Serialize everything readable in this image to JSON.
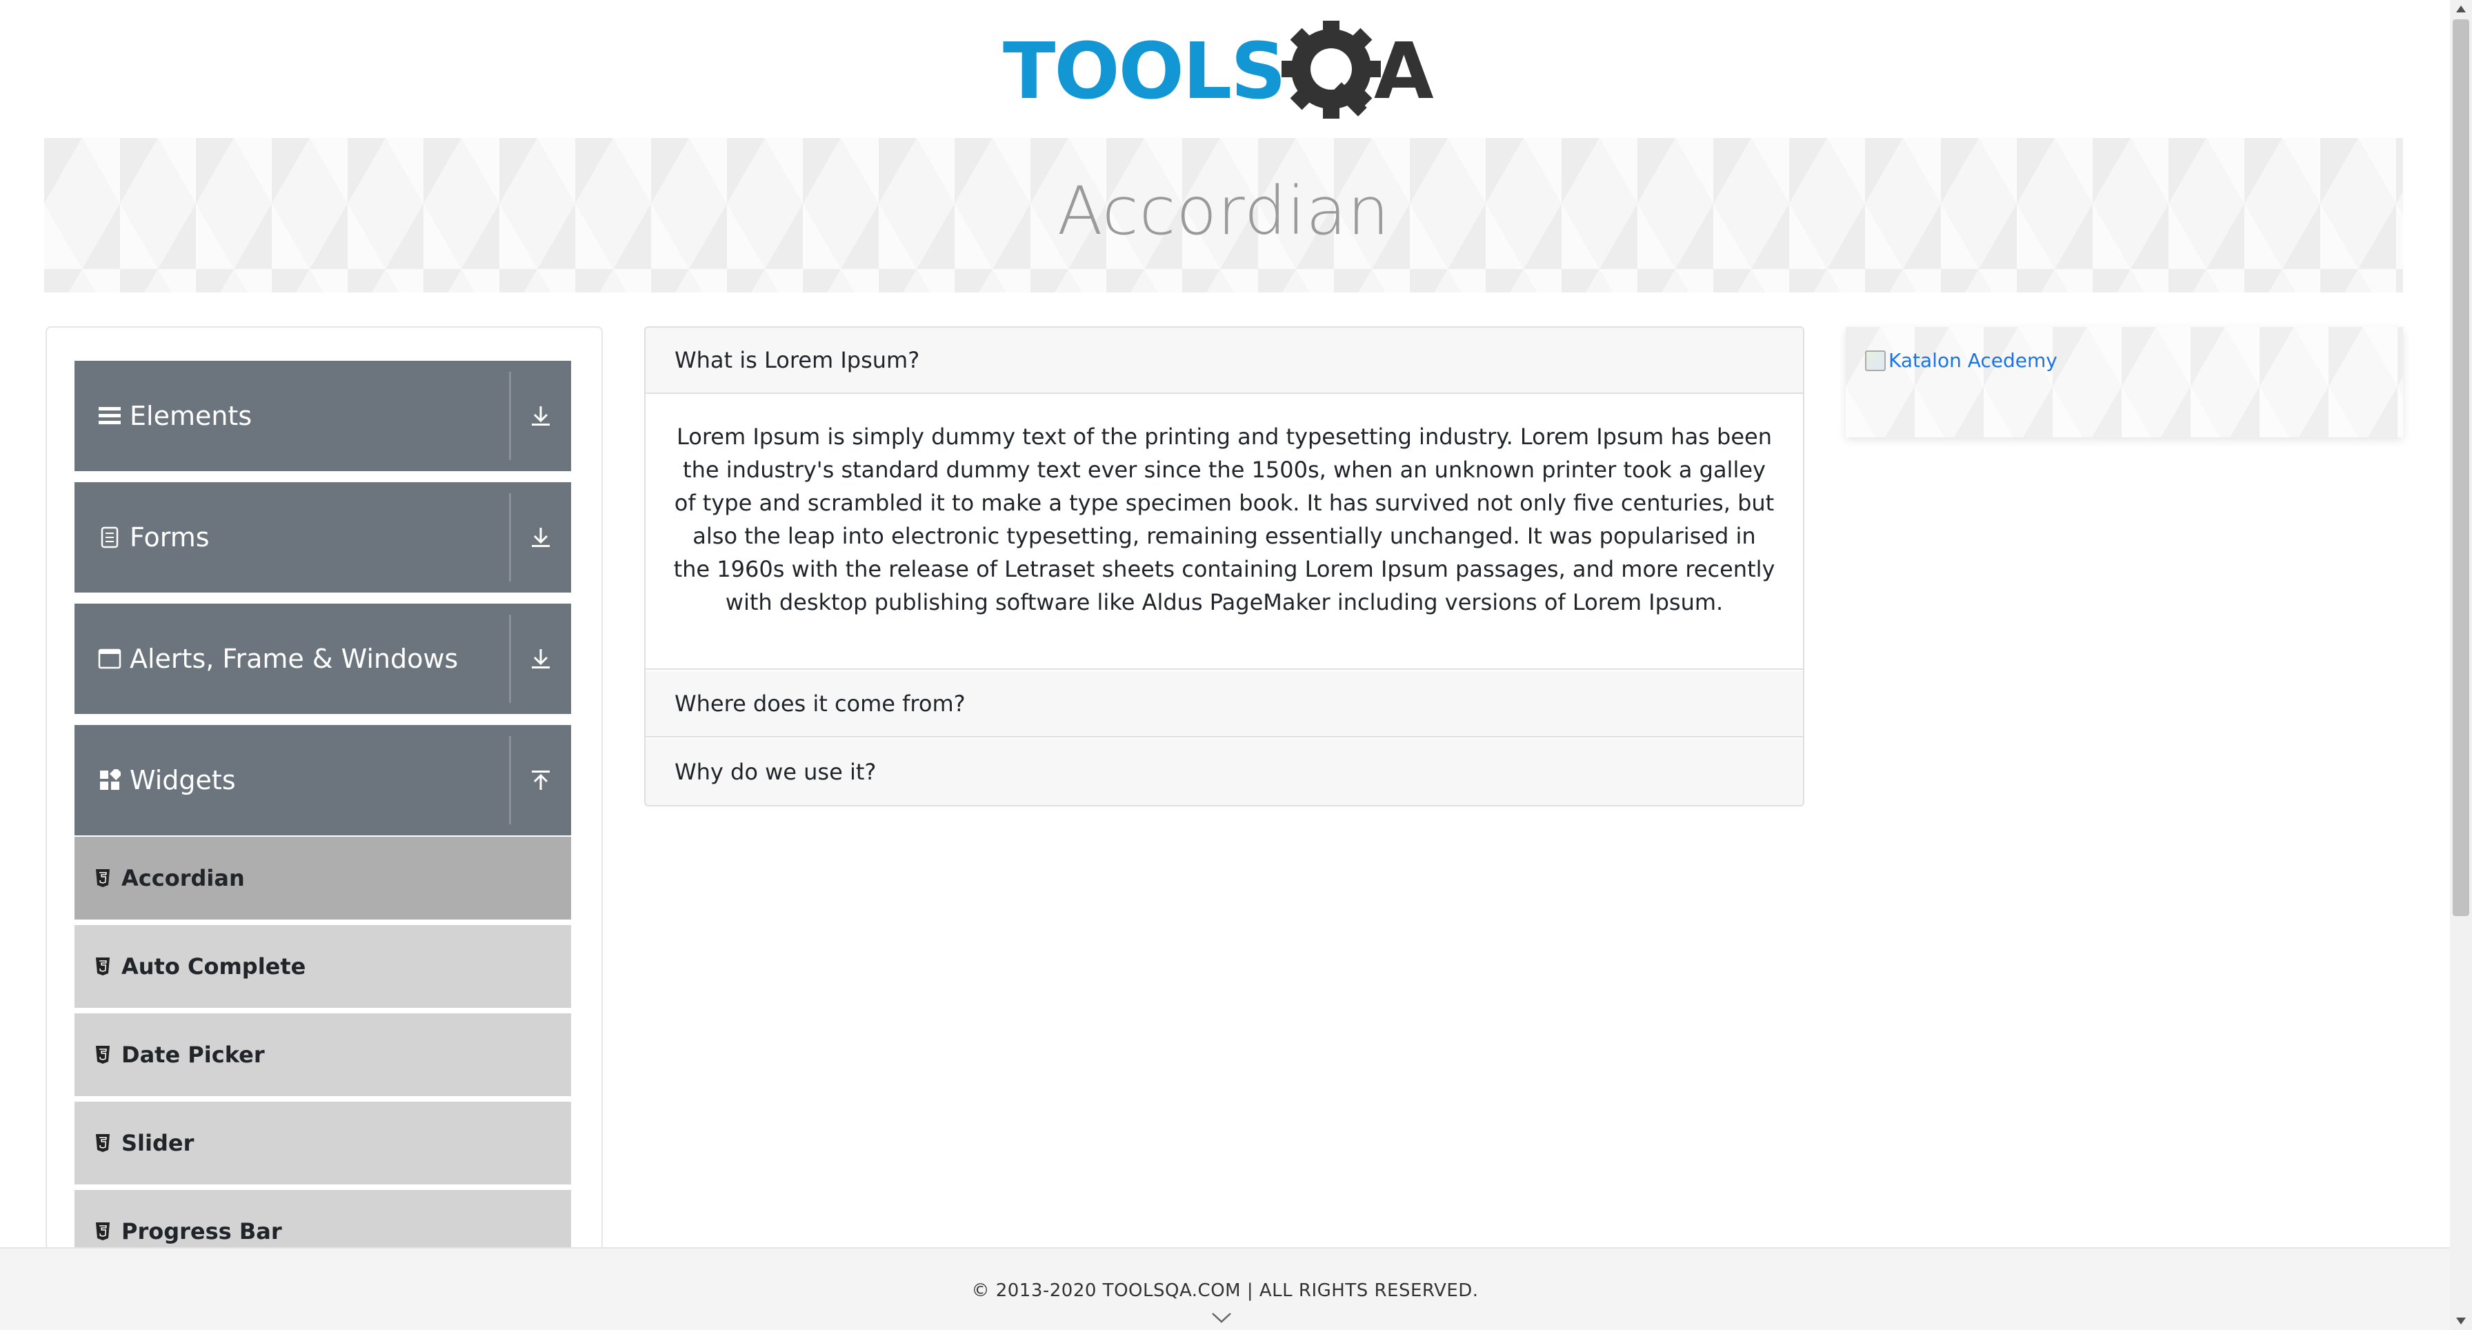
{
  "logo": {
    "text_left": "TOOLS",
    "text_right": "A",
    "brand_blue": "#1296d4",
    "brand_dark": "#333333"
  },
  "banner": {
    "title": "Accordian"
  },
  "sidebar": {
    "groups": [
      {
        "label": "Elements",
        "icon": "list-icon",
        "expanded": false
      },
      {
        "label": "Forms",
        "icon": "document-icon",
        "expanded": false
      },
      {
        "label": "Alerts, Frame & Windows",
        "icon": "window-icon",
        "expanded": false
      },
      {
        "label": "Widgets",
        "icon": "grid-icon",
        "expanded": true
      }
    ],
    "widget_items": [
      {
        "label": "Accordian",
        "active": true
      },
      {
        "label": "Auto Complete",
        "active": false
      },
      {
        "label": "Date Picker",
        "active": false
      },
      {
        "label": "Slider",
        "active": false
      },
      {
        "label": "Progress Bar",
        "active": false
      }
    ]
  },
  "accordion": {
    "sections": [
      {
        "title": "What is Lorem Ipsum?",
        "expanded": true,
        "body": "Lorem Ipsum is simply dummy text of the printing and typesetting industry. Lorem Ipsum has been the industry's standard dummy text ever since the 1500s, when an unknown printer took a galley of type and scrambled it to make a type specimen book. It has survived not only five centuries, but also the leap into electronic typesetting, remaining essentially unchanged. It was popularised in the 1960s with the release of Letraset sheets containing Lorem Ipsum passages, and more recently with desktop publishing software like Aldus PageMaker including versions of Lorem Ipsum."
      },
      {
        "title": "Where does it come from?",
        "expanded": false
      },
      {
        "title": "Why do we use it?",
        "expanded": false
      }
    ]
  },
  "ad": {
    "alt_text": "Katalon Acedemy"
  },
  "footer": {
    "copyright": "© 2013-2020 TOOLSQA.COM | ALL RIGHTS RESERVED."
  },
  "colors": {
    "menu_header": "#6c757d",
    "sub_item": "#d3d3d3",
    "sub_item_active": "#aeaeae",
    "link": "#1a73e8"
  }
}
